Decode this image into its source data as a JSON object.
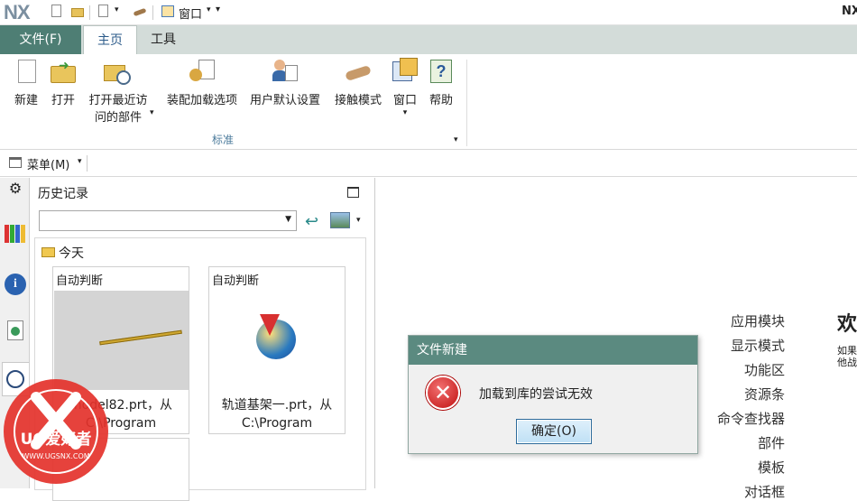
{
  "app": {
    "logo": "NX",
    "title_right": "NX"
  },
  "qat": {
    "window_label": "窗口"
  },
  "tabs": {
    "file": "文件(F)",
    "home": "主页",
    "tools": "工具"
  },
  "ribbon": {
    "new": "新建",
    "open": "打开",
    "open_recent_line1": "打开最近访",
    "open_recent_line2": "问的部件",
    "assembly": "装配加载选项",
    "user_defaults": "用户默认设置",
    "touch": "接触模式",
    "window": "窗口",
    "help": "帮助",
    "group": "标准"
  },
  "menubar": {
    "menu_label": "菜单(M)"
  },
  "history": {
    "title": "历史记录",
    "section": "今天",
    "items": [
      {
        "label": "自动判断",
        "caption_line1": "model82.prt，从",
        "caption_line2": "C:\\Program"
      },
      {
        "label": "自动判断",
        "caption_line1": "轨道基架一.prt，从",
        "caption_line2": "C:\\Program"
      }
    ]
  },
  "right_panel": {
    "links": [
      "应用模块",
      "显示模式",
      "功能区",
      "资源条",
      "命令查找器",
      "部件",
      "模板",
      "对话框"
    ],
    "welcome": "欢",
    "note_line1": "如果",
    "note_line2": "他战"
  },
  "dialog": {
    "title": "文件新建",
    "message": "加载到库的尝试无效",
    "ok": "确定(O)"
  },
  "watermark": {
    "brand": "UG爱好者",
    "url": "WWW.UGSNX.COM"
  },
  "colors": {
    "file_tab": "#4e7e74",
    "dialog_title": "#5b8a80",
    "tab_bar": "#d3dcd9"
  }
}
